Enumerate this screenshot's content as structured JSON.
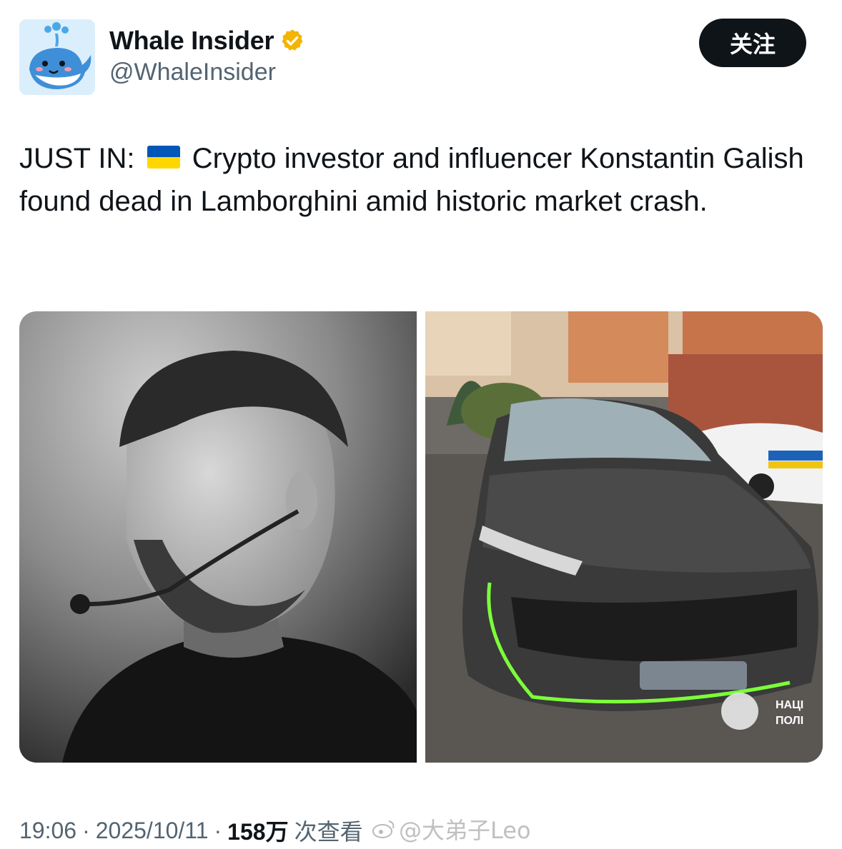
{
  "author": {
    "name": "Whale Insider",
    "handle": "@WhaleInsider",
    "avatar_icon": "whale-icon",
    "verified_badge_icon": "verified-badge-icon",
    "verified_color": "#f4b400"
  },
  "follow_button": {
    "label": "关注"
  },
  "tweet": {
    "prefix": "JUST IN:",
    "flag_icon": "ukraine-flag-icon",
    "body": "Crypto investor and influencer Konstantin Galish found dead in Lamborghini amid historic market crash."
  },
  "media": {
    "photo_left": {
      "kind": "portrait-photo"
    },
    "photo_right": {
      "kind": "car-photo",
      "overlay_line1": "НАЦІ",
      "overlay_line2": "ПОЛІ"
    }
  },
  "footer": {
    "time": "19:06",
    "separator": "·",
    "date": "2025/10/11",
    "views": "158万",
    "views_suffix": "次查看"
  },
  "watermark": {
    "text": "@大弟子Leo"
  },
  "colors": {
    "text": "#0f1419",
    "muted": "#536471",
    "button_bg": "#0f1419",
    "flag_blue": "#0057b7",
    "flag_yellow": "#ffd700"
  }
}
